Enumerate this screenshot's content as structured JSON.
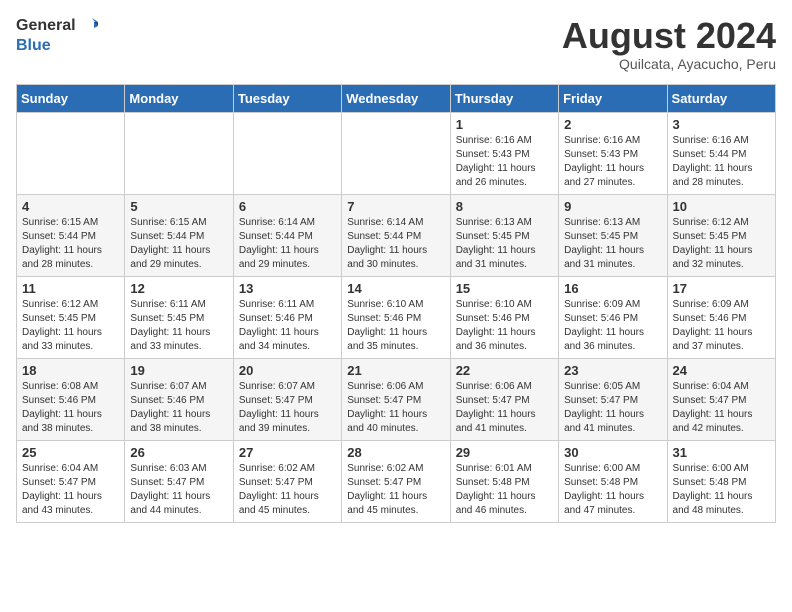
{
  "logo": {
    "general": "General",
    "blue": "Blue"
  },
  "title": "August 2024",
  "location": "Quilcata, Ayacucho, Peru",
  "headers": [
    "Sunday",
    "Monday",
    "Tuesday",
    "Wednesday",
    "Thursday",
    "Friday",
    "Saturday"
  ],
  "weeks": [
    [
      {
        "day": "",
        "info": ""
      },
      {
        "day": "",
        "info": ""
      },
      {
        "day": "",
        "info": ""
      },
      {
        "day": "",
        "info": ""
      },
      {
        "day": "1",
        "info": "Sunrise: 6:16 AM\nSunset: 5:43 PM\nDaylight: 11 hours\nand 26 minutes."
      },
      {
        "day": "2",
        "info": "Sunrise: 6:16 AM\nSunset: 5:43 PM\nDaylight: 11 hours\nand 27 minutes."
      },
      {
        "day": "3",
        "info": "Sunrise: 6:16 AM\nSunset: 5:44 PM\nDaylight: 11 hours\nand 28 minutes."
      }
    ],
    [
      {
        "day": "4",
        "info": "Sunrise: 6:15 AM\nSunset: 5:44 PM\nDaylight: 11 hours\nand 28 minutes."
      },
      {
        "day": "5",
        "info": "Sunrise: 6:15 AM\nSunset: 5:44 PM\nDaylight: 11 hours\nand 29 minutes."
      },
      {
        "day": "6",
        "info": "Sunrise: 6:14 AM\nSunset: 5:44 PM\nDaylight: 11 hours\nand 29 minutes."
      },
      {
        "day": "7",
        "info": "Sunrise: 6:14 AM\nSunset: 5:44 PM\nDaylight: 11 hours\nand 30 minutes."
      },
      {
        "day": "8",
        "info": "Sunrise: 6:13 AM\nSunset: 5:45 PM\nDaylight: 11 hours\nand 31 minutes."
      },
      {
        "day": "9",
        "info": "Sunrise: 6:13 AM\nSunset: 5:45 PM\nDaylight: 11 hours\nand 31 minutes."
      },
      {
        "day": "10",
        "info": "Sunrise: 6:12 AM\nSunset: 5:45 PM\nDaylight: 11 hours\nand 32 minutes."
      }
    ],
    [
      {
        "day": "11",
        "info": "Sunrise: 6:12 AM\nSunset: 5:45 PM\nDaylight: 11 hours\nand 33 minutes."
      },
      {
        "day": "12",
        "info": "Sunrise: 6:11 AM\nSunset: 5:45 PM\nDaylight: 11 hours\nand 33 minutes."
      },
      {
        "day": "13",
        "info": "Sunrise: 6:11 AM\nSunset: 5:46 PM\nDaylight: 11 hours\nand 34 minutes."
      },
      {
        "day": "14",
        "info": "Sunrise: 6:10 AM\nSunset: 5:46 PM\nDaylight: 11 hours\nand 35 minutes."
      },
      {
        "day": "15",
        "info": "Sunrise: 6:10 AM\nSunset: 5:46 PM\nDaylight: 11 hours\nand 36 minutes."
      },
      {
        "day": "16",
        "info": "Sunrise: 6:09 AM\nSunset: 5:46 PM\nDaylight: 11 hours\nand 36 minutes."
      },
      {
        "day": "17",
        "info": "Sunrise: 6:09 AM\nSunset: 5:46 PM\nDaylight: 11 hours\nand 37 minutes."
      }
    ],
    [
      {
        "day": "18",
        "info": "Sunrise: 6:08 AM\nSunset: 5:46 PM\nDaylight: 11 hours\nand 38 minutes."
      },
      {
        "day": "19",
        "info": "Sunrise: 6:07 AM\nSunset: 5:46 PM\nDaylight: 11 hours\nand 38 minutes."
      },
      {
        "day": "20",
        "info": "Sunrise: 6:07 AM\nSunset: 5:47 PM\nDaylight: 11 hours\nand 39 minutes."
      },
      {
        "day": "21",
        "info": "Sunrise: 6:06 AM\nSunset: 5:47 PM\nDaylight: 11 hours\nand 40 minutes."
      },
      {
        "day": "22",
        "info": "Sunrise: 6:06 AM\nSunset: 5:47 PM\nDaylight: 11 hours\nand 41 minutes."
      },
      {
        "day": "23",
        "info": "Sunrise: 6:05 AM\nSunset: 5:47 PM\nDaylight: 11 hours\nand 41 minutes."
      },
      {
        "day": "24",
        "info": "Sunrise: 6:04 AM\nSunset: 5:47 PM\nDaylight: 11 hours\nand 42 minutes."
      }
    ],
    [
      {
        "day": "25",
        "info": "Sunrise: 6:04 AM\nSunset: 5:47 PM\nDaylight: 11 hours\nand 43 minutes."
      },
      {
        "day": "26",
        "info": "Sunrise: 6:03 AM\nSunset: 5:47 PM\nDaylight: 11 hours\nand 44 minutes."
      },
      {
        "day": "27",
        "info": "Sunrise: 6:02 AM\nSunset: 5:47 PM\nDaylight: 11 hours\nand 45 minutes."
      },
      {
        "day": "28",
        "info": "Sunrise: 6:02 AM\nSunset: 5:47 PM\nDaylight: 11 hours\nand 45 minutes."
      },
      {
        "day": "29",
        "info": "Sunrise: 6:01 AM\nSunset: 5:48 PM\nDaylight: 11 hours\nand 46 minutes."
      },
      {
        "day": "30",
        "info": "Sunrise: 6:00 AM\nSunset: 5:48 PM\nDaylight: 11 hours\nand 47 minutes."
      },
      {
        "day": "31",
        "info": "Sunrise: 6:00 AM\nSunset: 5:48 PM\nDaylight: 11 hours\nand 48 minutes."
      }
    ]
  ]
}
